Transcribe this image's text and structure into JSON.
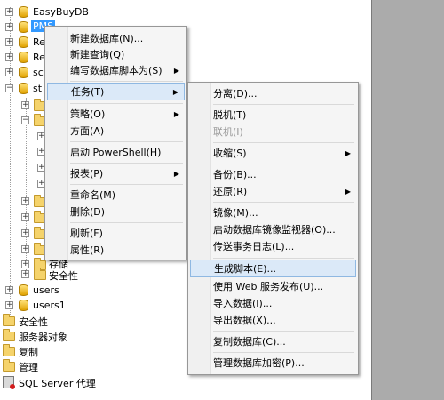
{
  "tree": {
    "items": [
      {
        "label": "EasyBuyDB",
        "icon": "db",
        "toggle": "+"
      },
      {
        "label": "PMS",
        "icon": "db",
        "toggle": "+"
      },
      {
        "label": "Re",
        "icon": "db",
        "toggle": "+"
      },
      {
        "label": "Re",
        "icon": "db",
        "toggle": "+"
      },
      {
        "label": "sc",
        "icon": "db",
        "toggle": "+"
      },
      {
        "label": "st",
        "icon": "db",
        "toggle": "−"
      },
      {
        "label": "存储",
        "icon": "folder",
        "toggle": "+"
      },
      {
        "label": "安全性",
        "icon": "folder",
        "toggle": "+"
      },
      {
        "label": "users",
        "icon": "db",
        "toggle": "+"
      },
      {
        "label": "users1",
        "icon": "db",
        "toggle": "+"
      },
      {
        "label": "安全性",
        "icon": "folder",
        "toggle": ""
      },
      {
        "label": "服务器对象",
        "icon": "folder",
        "toggle": ""
      },
      {
        "label": "复制",
        "icon": "folder",
        "toggle": ""
      },
      {
        "label": "管理",
        "icon": "folder",
        "toggle": ""
      },
      {
        "label": "SQL Server 代理",
        "icon": "agent",
        "toggle": ""
      }
    ]
  },
  "context_menu": {
    "items": [
      {
        "label": "新建数据库(N)...",
        "submenu": false
      },
      {
        "label": "新建查询(Q)",
        "submenu": false
      },
      {
        "label": "编写数据库脚本为(S)",
        "submenu": true
      },
      {
        "label": "任务(T)",
        "submenu": true,
        "highlighted": true
      },
      {
        "label": "策略(O)",
        "submenu": true
      },
      {
        "label": "方面(A)",
        "submenu": false
      },
      {
        "label": "启动 PowerShell(H)",
        "submenu": false
      },
      {
        "label": "报表(P)",
        "submenu": true
      },
      {
        "label": "重命名(M)",
        "submenu": false
      },
      {
        "label": "删除(D)",
        "submenu": false
      },
      {
        "label": "刷新(F)",
        "submenu": false
      },
      {
        "label": "属性(R)",
        "submenu": false
      }
    ]
  },
  "tasks_menu": {
    "items": [
      {
        "label": "分离(D)...",
        "submenu": false
      },
      {
        "label": "脱机(T)",
        "submenu": false
      },
      {
        "label": "联机(I)",
        "submenu": false,
        "disabled": true
      },
      {
        "label": "收缩(S)",
        "submenu": true
      },
      {
        "label": "备份(B)...",
        "submenu": false
      },
      {
        "label": "还原(R)",
        "submenu": true
      },
      {
        "label": "镜像(M)...",
        "submenu": false
      },
      {
        "label": "启动数据库镜像监视器(O)...",
        "submenu": false
      },
      {
        "label": "传送事务日志(L)...",
        "submenu": false
      },
      {
        "label": "生成脚本(E)...",
        "submenu": false,
        "highlighted": true
      },
      {
        "label": "使用 Web 服务发布(U)...",
        "submenu": false
      },
      {
        "label": "导入数据(I)...",
        "submenu": false
      },
      {
        "label": "导出数据(X)...",
        "submenu": false
      },
      {
        "label": "复制数据库(C)...",
        "submenu": false
      },
      {
        "label": "管理数据库加密(P)...",
        "submenu": false
      }
    ]
  },
  "colors": {
    "selection": "#3399ff",
    "menu_highlight": "#dbe9f8",
    "side_pane": "#ababab"
  }
}
